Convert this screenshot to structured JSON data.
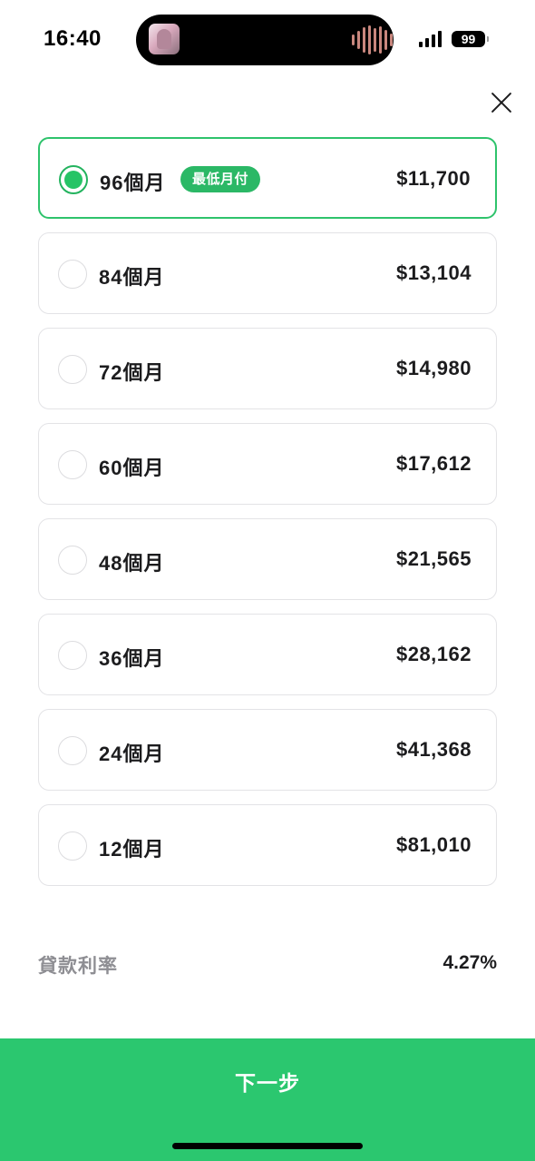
{
  "status_bar": {
    "time": "16:40",
    "battery": "99",
    "icons": [
      "now-playing-artwork",
      "audio-waveform-icon",
      "signal-bars-icon",
      "battery-icon"
    ]
  },
  "header": {
    "close_icon": "close-icon"
  },
  "options": [
    {
      "term": "96個月",
      "badge": "最低月付",
      "price": "$11,700",
      "selected": true
    },
    {
      "term": "84個月",
      "price": "$13,104",
      "selected": false
    },
    {
      "term": "72個月",
      "price": "$14,980",
      "selected": false
    },
    {
      "term": "60個月",
      "price": "$17,612",
      "selected": false
    },
    {
      "term": "48個月",
      "price": "$21,565",
      "selected": false
    },
    {
      "term": "36個月",
      "price": "$28,162",
      "selected": false
    },
    {
      "term": "24個月",
      "price": "$41,368",
      "selected": false
    },
    {
      "term": "12個月",
      "price": "$81,010",
      "selected": false
    }
  ],
  "loan_rate": {
    "label": "貸款利率",
    "value": "4.27%"
  },
  "footer": {
    "next_label": "下一步"
  },
  "colors": {
    "accent": "#2bc76f",
    "badge": "#2bb866",
    "muted_text": "#8e8e93",
    "border": "#e3e3e6"
  }
}
